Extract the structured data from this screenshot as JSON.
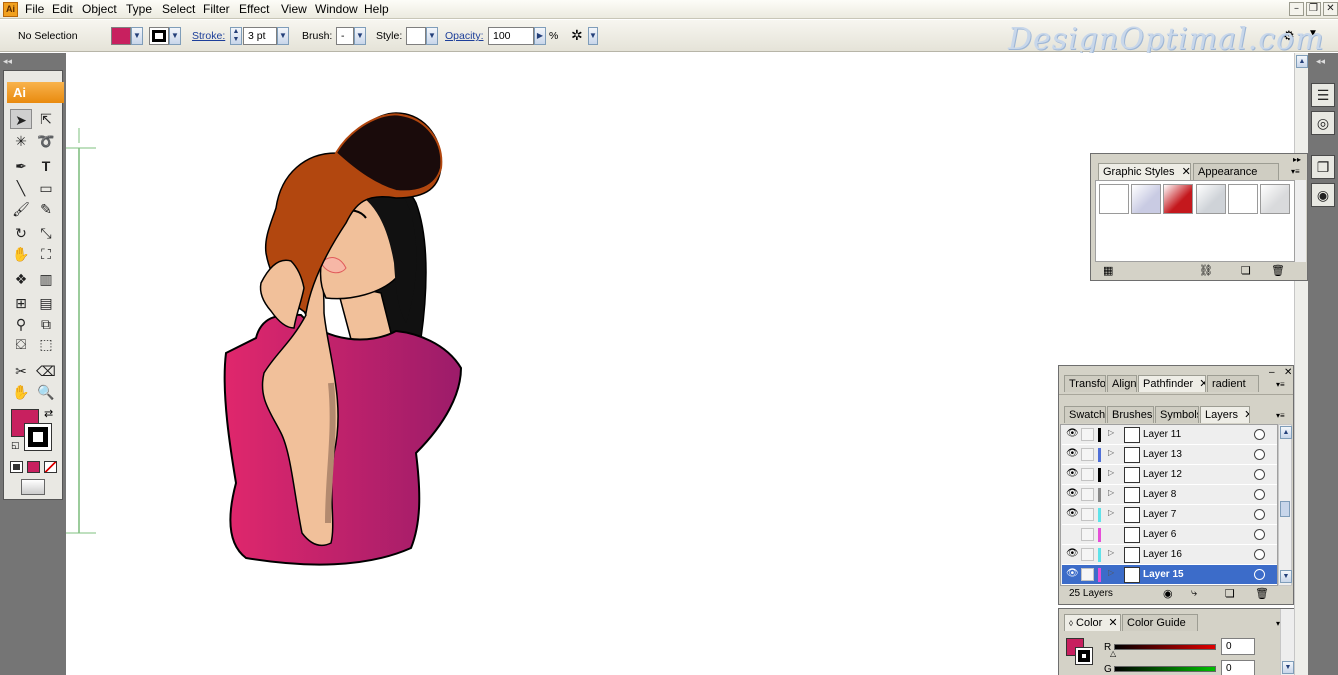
{
  "menubar": {
    "app_icon": "Ai",
    "items": [
      "File",
      "Edit",
      "Object",
      "Type",
      "Select",
      "Filter",
      "Effect",
      "View",
      "Window",
      "Help"
    ],
    "window_buttons": [
      "minimize-icon",
      "restore-icon",
      "close-icon"
    ]
  },
  "controlbar": {
    "selection": "No Selection",
    "fill_color": "#c8205f",
    "stroke_label": "Stroke:",
    "stroke_value": "3 pt",
    "brush_label": "Brush:",
    "brush_value": "-",
    "style_label": "Style:",
    "opacity_label": "Opacity:",
    "opacity_value": "100",
    "percent": "%"
  },
  "watermark": "DesignOptimal.com",
  "toolbox": {
    "logo": "Ai",
    "fill_color": "#c8205f",
    "stroke_color": "#000000",
    "tools": [
      "selection-tool",
      "direct-selection-tool",
      "magic-wand-tool",
      "lasso-tool",
      "pen-tool",
      "type-tool",
      "line-segment-tool",
      "rectangle-tool",
      "paintbrush-tool",
      "pencil-tool",
      "rotate-tool",
      "scale-tool",
      "warp-tool",
      "free-transform-tool",
      "symbol-sprayer-tool",
      "column-graph-tool",
      "mesh-tool",
      "gradient-tool",
      "eyedropper-tool",
      "blend-tool",
      "live-paint-bucket-tool",
      "live-paint-selection-tool",
      "slice-tool",
      "eraser-tool",
      "hand-tool",
      "zoom-tool"
    ]
  },
  "graphic_styles_panel": {
    "tabs": [
      "Graphic Styles",
      "Appearance"
    ],
    "styles": [
      "#ffffff",
      "#c9cbe3",
      "#c4181d",
      "#cfd3d8",
      "#ffffff",
      "#d9dadc"
    ]
  },
  "pathfinder_panel": {
    "tabs": [
      "Transfo",
      "Align",
      "Pathfinder",
      "radient"
    ]
  },
  "layers_panel": {
    "tabs": [
      "Swatche",
      "Brushes",
      "Symbols",
      "Layers"
    ],
    "layers": [
      {
        "name": "Layer 11",
        "color": "#000000",
        "expandable": true,
        "visible": true,
        "selected": false
      },
      {
        "name": "Layer 13",
        "color": "#4f6fd6",
        "expandable": true,
        "visible": true,
        "selected": false
      },
      {
        "name": "Layer 12",
        "color": "#000000",
        "expandable": true,
        "visible": true,
        "selected": false
      },
      {
        "name": "Layer 8",
        "color": "#8a8a8a",
        "expandable": true,
        "visible": true,
        "selected": false
      },
      {
        "name": "Layer 7",
        "color": "#5fe3ea",
        "expandable": true,
        "visible": true,
        "selected": false
      },
      {
        "name": "Layer 6",
        "color": "#e54fd8",
        "expandable": false,
        "visible": false,
        "selected": false
      },
      {
        "name": "Layer 16",
        "color": "#5fe3ea",
        "expandable": true,
        "visible": true,
        "selected": false
      },
      {
        "name": "Layer 15",
        "color": "#e54fd8",
        "expandable": true,
        "visible": true,
        "selected": true
      }
    ],
    "count": "25 Layers"
  },
  "color_panel": {
    "tabs": [
      "Color",
      "Color Guide"
    ],
    "fill_color": "#c8205f",
    "r_label": "R",
    "r_value": "0",
    "g_label": "G",
    "g_value": "0"
  }
}
